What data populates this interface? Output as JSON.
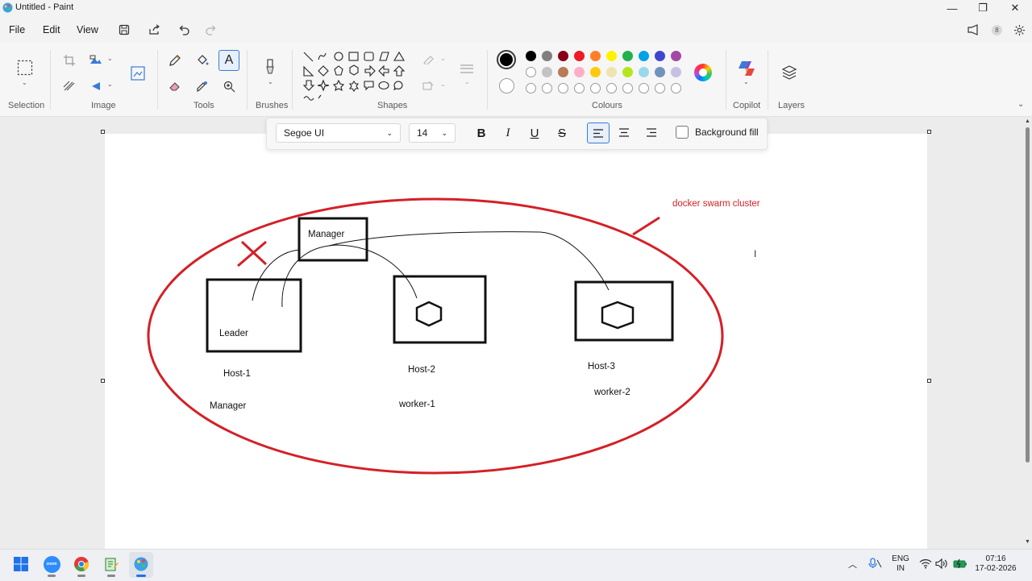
{
  "window": {
    "title": "Untitled - Paint",
    "min_glyph": "—",
    "max_glyph": "❐",
    "close_glyph": "✕"
  },
  "menu": {
    "file": "File",
    "edit": "Edit",
    "view": "View"
  },
  "ribbon": {
    "groups": {
      "selection": "Selection",
      "image": "Image",
      "tools": "Tools",
      "brushes": "Brushes",
      "shapes": "Shapes",
      "colours": "Colours",
      "copilot": "Copilot",
      "layers": "Layers"
    },
    "palette_row1": [
      "#000000",
      "#7f7f7f",
      "#880015",
      "#ed1c24",
      "#ff7f27",
      "#fff200",
      "#22b14c",
      "#00a2e8",
      "#3f48cc",
      "#a349a4"
    ],
    "palette_row2": [
      "#ffffff",
      "#c3c3c3",
      "#b97a57",
      "#ffaec9",
      "#ffc90e",
      "#efe4b0",
      "#b5e61d",
      "#99d9ea",
      "#7092be",
      "#c8bfe7"
    ],
    "primary_colour": "#000000",
    "secondary_colour": "#ffffff"
  },
  "text_toolbar": {
    "font": "Segoe UI",
    "size": "14",
    "bold": "B",
    "italic": "I",
    "underline": "U",
    "strike": "S",
    "background_fill": "Background fill"
  },
  "drawing": {
    "cluster_label": "docker swarm cluster",
    "box_manager": "Manager",
    "box_leader": "Leader",
    "host1": "Host-1",
    "host1_role": "Manager",
    "host2": "Host-2",
    "host2_role": "worker-1",
    "host3": "Host-3",
    "host3_role": "worker-2",
    "accent": "#d42027"
  },
  "taskbar": {
    "lang_top": "ENG",
    "lang_bottom": "IN",
    "time": "07:16",
    "date": "17-02-2026"
  }
}
